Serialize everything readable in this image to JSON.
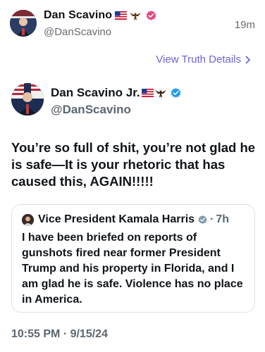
{
  "truth_post": {
    "author_name": "Dan Scavino",
    "author_handle": "@DanScavino",
    "time_ago": "19m",
    "details_link": "View Truth Details",
    "name_emoji_icons": [
      "us-flag-icon",
      "eagle-icon"
    ],
    "badge_color": "#e4497f"
  },
  "x_post": {
    "author_name": "Dan Scavino Jr.",
    "author_handle": "@DanScavino",
    "name_emoji_icons": [
      "us-flag-icon",
      "eagle-icon"
    ],
    "badge_color": "#1d9bf0",
    "text": "You’re so full of shit, you’re not glad he is safe—It is your rhetoric that has caused this, AGAIN!!!!!",
    "timestamp": "10:55 PM · 9/15/24",
    "quoted": {
      "author_name": "Vice President Kamala Harris",
      "dot": "·",
      "time_ago": "7h",
      "badge_color": "#829aab",
      "text": "I have been briefed on reports of gunshots fired near former President Trump and his property in Florida, and I am glad he is safe. Violence has no place in America."
    }
  }
}
